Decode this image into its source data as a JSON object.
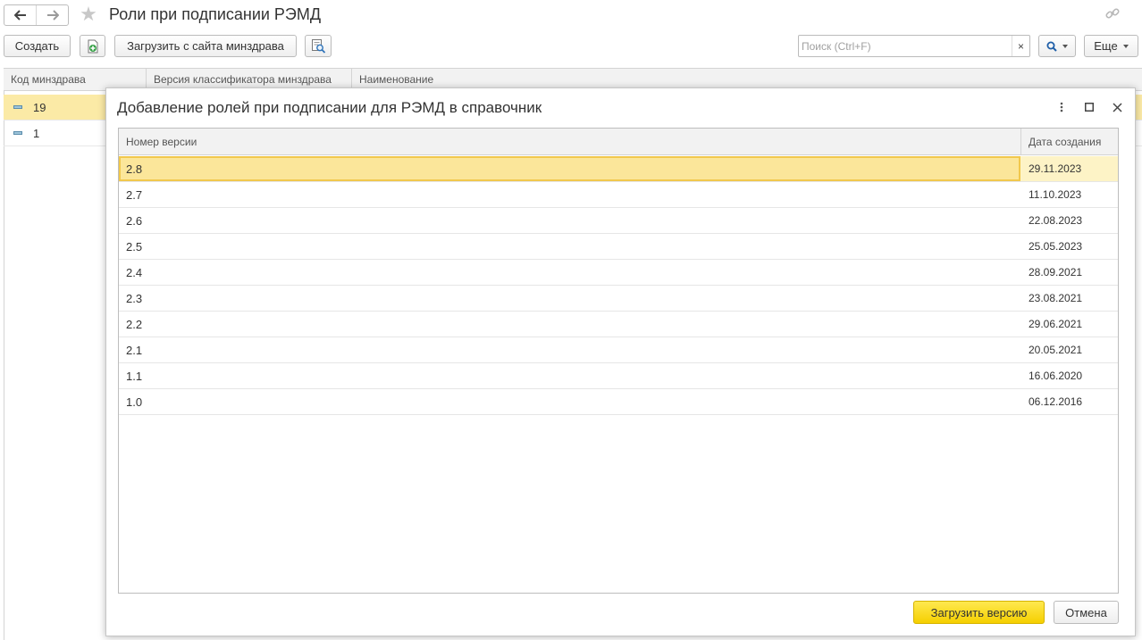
{
  "window": {
    "title": "Роли при подписании РЭМД",
    "back_icon": "arrow-left-icon",
    "forward_icon": "arrow-right-icon",
    "favorite_icon": "star-icon",
    "link_icon": "link-icon"
  },
  "toolbar": {
    "create_label": "Создать",
    "copy_icon": "add-copy-icon",
    "load_label": "Загрузить с сайта минздрава",
    "find_icon": "find-in-list-icon",
    "search": {
      "placeholder": "Поиск (Ctrl+F)",
      "value": "",
      "clear_label": "×"
    },
    "search_button_icon": "search-icon",
    "more_label": "Еще"
  },
  "main_list": {
    "columns": [
      "Код минздрава",
      "Версия классификатора минздрава",
      "Наименование"
    ],
    "rows": [
      {
        "code": "19",
        "selected": true
      },
      {
        "code": "1",
        "selected": false
      }
    ]
  },
  "dialog": {
    "title": "Добавление ролей при подписании для РЭМД в справочник",
    "menu_icon": "more-vertical-icon",
    "maximize_icon": "maximize-icon",
    "close_icon": "close-icon",
    "columns": {
      "version": "Номер версии",
      "date": "Дата создания"
    },
    "rows": [
      {
        "version": "2.8",
        "date": "29.11.2023"
      },
      {
        "version": "2.7",
        "date": "11.10.2023"
      },
      {
        "version": "2.6",
        "date": "22.08.2023"
      },
      {
        "version": "2.5",
        "date": "25.05.2023"
      },
      {
        "version": "2.4",
        "date": "28.09.2021"
      },
      {
        "version": "2.3",
        "date": "23.08.2021"
      },
      {
        "version": "2.2",
        "date": "29.06.2021"
      },
      {
        "version": "2.1",
        "date": "20.05.2021"
      },
      {
        "version": "1.1",
        "date": "16.06.2020"
      },
      {
        "version": "1.0",
        "date": "06.12.2016"
      }
    ],
    "selected_row": 0,
    "load_version_label": "Загрузить версию",
    "cancel_label": "Отмена"
  },
  "colors": {
    "selection": "#fbeaa6",
    "primary_button": "#f5cf00",
    "row_marker": "#5b8dac"
  }
}
